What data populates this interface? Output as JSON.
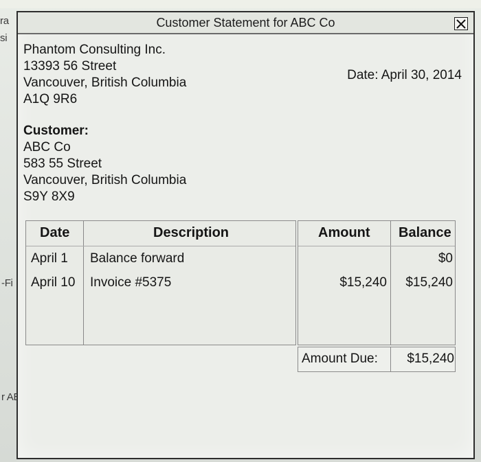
{
  "background": {
    "fragments": [
      "ra",
      "si",
      "-Fi",
      "r AB"
    ]
  },
  "window": {
    "title": "Customer Statement for ABC Co",
    "close_glyph": "✕",
    "close_icon": "close-icon"
  },
  "seller": {
    "name": "Phantom Consulting Inc.",
    "street": "13393 56 Street",
    "city": "Vancouver, British Columbia",
    "postal": "A1Q 9R6"
  },
  "date_label": "Date: April 30, 2014",
  "customer": {
    "label": "Customer:",
    "name": "ABC Co",
    "street": "583 55 Street",
    "city": "Vancouver, British Columbia",
    "postal": "S9Y 8X9"
  },
  "table": {
    "headers": {
      "date": "Date",
      "description": "Description",
      "amount": "Amount",
      "balance": "Balance"
    },
    "rows": [
      {
        "date": "April 1",
        "description": "Balance forward",
        "amount": "",
        "balance": "$0"
      },
      {
        "date": "April 10",
        "description": "Invoice #5375",
        "amount": "$15,240",
        "balance": "$15,240"
      }
    ]
  },
  "amount_due": {
    "label": "Amount Due:",
    "value": "$15,240"
  }
}
